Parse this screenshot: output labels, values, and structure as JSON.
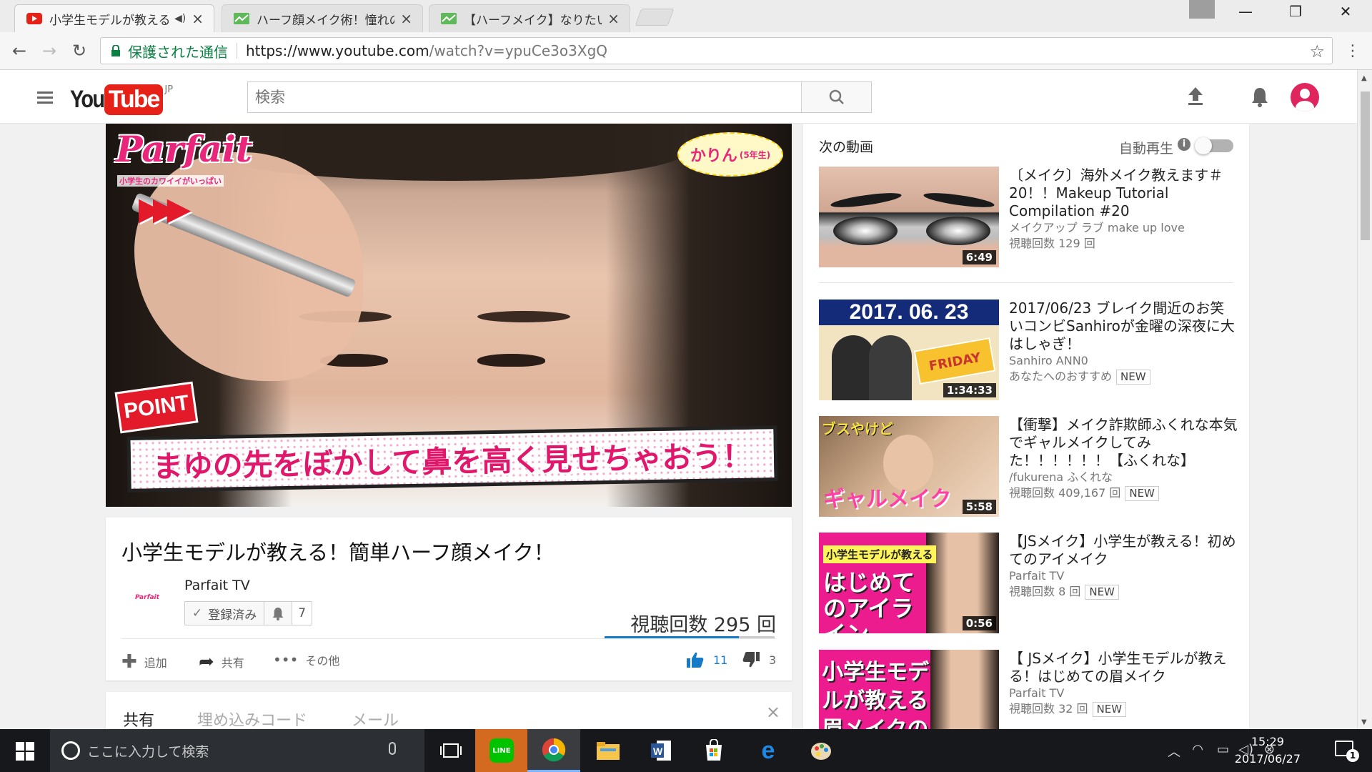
{
  "browser": {
    "tabs": [
      {
        "title": "小学生モデルが教える！",
        "favicon": "youtube-icon",
        "audio": true
      },
      {
        "title": "ハーフ顔メイク術！憧れの外",
        "favicon": "site-icon"
      },
      {
        "title": "【ハーフメイク】なりたい顔その",
        "favicon": "site-icon"
      }
    ],
    "security_label": "保護された通信",
    "url_host": "https://www.youtube.com",
    "url_path": "/watch?v=ypuCe3o3XgQ"
  },
  "youtube": {
    "logo_you": "You",
    "logo_tube": "Tube",
    "logo_region": "JP",
    "search_placeholder": "検索"
  },
  "player": {
    "logo": "Parfait",
    "logo_tagline": "小学生のカワイイがいっぱい",
    "name_tag": "かりん",
    "name_tag_grade": "(5年生)",
    "point_label": "POINT",
    "caption": "まゆの先をぼかして鼻を高く見せちゃおう！"
  },
  "video": {
    "title": "小学生モデルが教える！簡単ハーフ顔メイク！",
    "channel": "Parfait TV",
    "channel_thumb_text": "Parfait",
    "subscribe_label": "登録済み",
    "subscriber_count": "7",
    "view_count": "視聴回数 295 回",
    "like_ratio": 0.79,
    "actions": {
      "add": "追加",
      "share": "共有",
      "more": "その他"
    },
    "likes": "11",
    "dislikes": "3"
  },
  "share": {
    "tabs": [
      "共有",
      "埋め込みコード",
      "メール"
    ],
    "close": "×"
  },
  "sidebar": {
    "up_next_label": "次の動画",
    "autoplay_label": "自動再生",
    "autoplay_info": "i",
    "videos": [
      {
        "title": "〔メイク〕海外メイク教えます＃20！！Makeup Tutorial Compilation #20",
        "channel": "メイクアップ ラブ make up love",
        "views": "視聴回数 129 回",
        "duration": "6:49",
        "badge": ""
      },
      {
        "title": "2017/06/23 ブレイク間近のお笑いコンビSanhiroが金曜の深夜に大はしゃぎ！",
        "channel": "Sanhiro ANN0",
        "views": "あなたへのおすすめ",
        "duration": "1:34:33",
        "badge": "NEW",
        "thumb_banner": "2017. 06. 23",
        "thumb_label": "FRIDAY"
      },
      {
        "title": "【衝撃】メイク詐欺師ふくれな本気でギャルメイクしてみた！！！！！！【ふくれな】",
        "channel": "/fukurena ふくれな",
        "views": "視聴回数 409,167 回",
        "duration": "5:58",
        "badge": "NEW",
        "thumb_top": "ブスやけど",
        "thumb_bottom": "ギャルメイク"
      },
      {
        "title": "【JSメイク】小学生が教える！初めてのアイメイク",
        "channel": "Parfait TV",
        "views": "視聴回数 8 回",
        "duration": "0:56",
        "badge": "NEW",
        "thumb_label": "小学生モデルが教える",
        "thumb_big": "はじめてのアイライン"
      },
      {
        "title": "【 JSメイク】小学生モデルが教える！はじめての眉メイク",
        "channel": "Parfait TV",
        "views": "視聴回数 32 回",
        "duration": "",
        "badge": "NEW",
        "thumb_big": "小学生モデルが教える 眉メイクのやり方"
      }
    ]
  },
  "taskbar": {
    "search_placeholder": "ここに入力して検索",
    "time": "15:29",
    "date": "2017/06/27",
    "notification_count": "1",
    "line_label": "LINE"
  },
  "colors": {
    "youtube_red": "#e62117",
    "link_blue": "#167ac6",
    "secure_green": "#0b8043",
    "parfait_pink": "#e8267a"
  }
}
